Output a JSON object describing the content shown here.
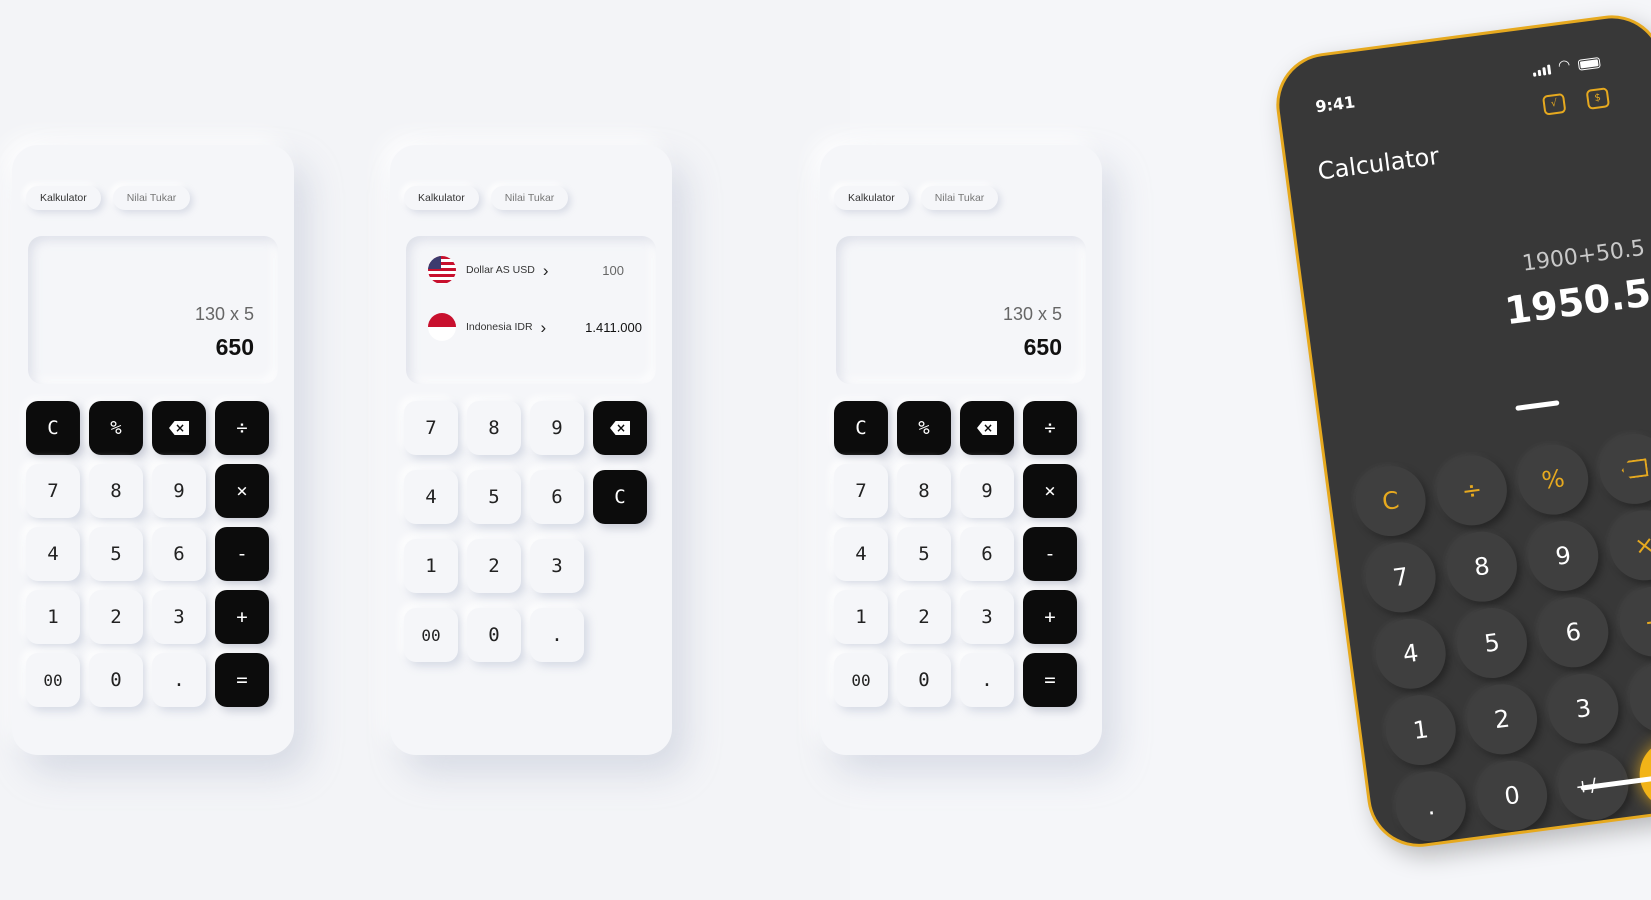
{
  "tabs": {
    "calculator": "Kalkulator",
    "exchange": "Nilai Tukar"
  },
  "calc": {
    "expression": "130 x 5",
    "result": "650",
    "keys": {
      "clear": "C",
      "percent": "%",
      "divide": "÷",
      "seven": "7",
      "eight": "8",
      "nine": "9",
      "multiply": "×",
      "four": "4",
      "five": "5",
      "six": "6",
      "minus": "-",
      "one": "1",
      "two": "2",
      "three": "3",
      "plus": "+",
      "double_zero": "00",
      "zero": "0",
      "decimal": ".",
      "equals": "="
    }
  },
  "converter": {
    "from": {
      "name": "Dollar AS USD",
      "value": "100"
    },
    "to": {
      "name": "Indonesia IDR",
      "value": "1.411.000"
    }
  },
  "phone": {
    "time": "9:41",
    "title": "Calculator",
    "expression": "1900+50.5",
    "result": "1950.5",
    "keys": {
      "clear": "C",
      "divide": "÷",
      "percent": "%",
      "multiply": "×",
      "seven": "7",
      "eight": "8",
      "nine": "9",
      "minus": "−",
      "four": "4",
      "five": "5",
      "six": "6",
      "plus": "+",
      "one": "1",
      "two": "2",
      "three": "3",
      "equals": "=",
      "decimal": ".",
      "zero": "0",
      "plus_minus": "+∕−"
    }
  }
}
